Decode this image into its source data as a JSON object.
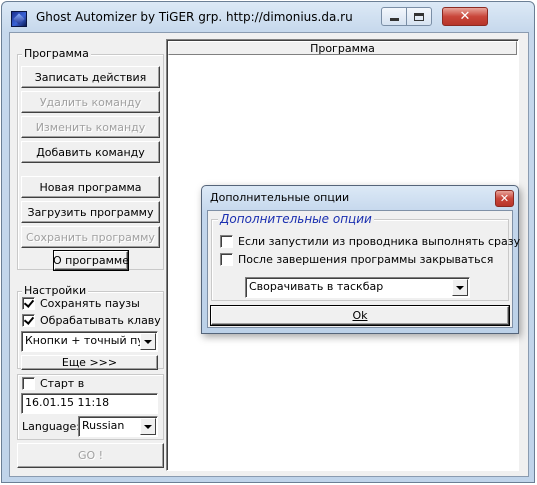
{
  "window": {
    "title": "Ghost Automizer by TiGER grp. http://dimonius.da.ru"
  },
  "program_group": {
    "legend": "Программа",
    "record_button": "Записать действия",
    "delete_command_button": "Удалить команду",
    "edit_command_button": "Изменить команду",
    "add_command_button": "Добавить команду",
    "new_program_button": "Новая программа",
    "load_program_button": "Загрузить программу",
    "save_program_button": "Сохранить программу",
    "about_button": "О программе"
  },
  "settings_group": {
    "legend": "Настройки",
    "save_pauses": {
      "label": "Сохранять паузы",
      "checked": true
    },
    "process_keys": {
      "label": "Обрабатывать клаву",
      "checked": true
    },
    "mode_select": "Кнопки + точный путь",
    "more_button": "Еще >>>",
    "start_at": {
      "label": "Старт в",
      "checked": false
    },
    "start_datetime": "16.01.15 11:18",
    "language_label": "Language:",
    "language_value": "Russian",
    "go_button": "GO !"
  },
  "program_list": {
    "header": "Программа"
  },
  "dialog": {
    "title": "Дополнительные опции",
    "group_title": "Дополнительные опции",
    "run_from_explorer": {
      "label": "Если запустили из проводника выполнять сразу",
      "checked": false
    },
    "close_after_finish": {
      "label": "После завершения программы закрываться",
      "checked": false
    },
    "minimize_select": "Сворачивать в таскбар",
    "ok_button": "Ok"
  }
}
